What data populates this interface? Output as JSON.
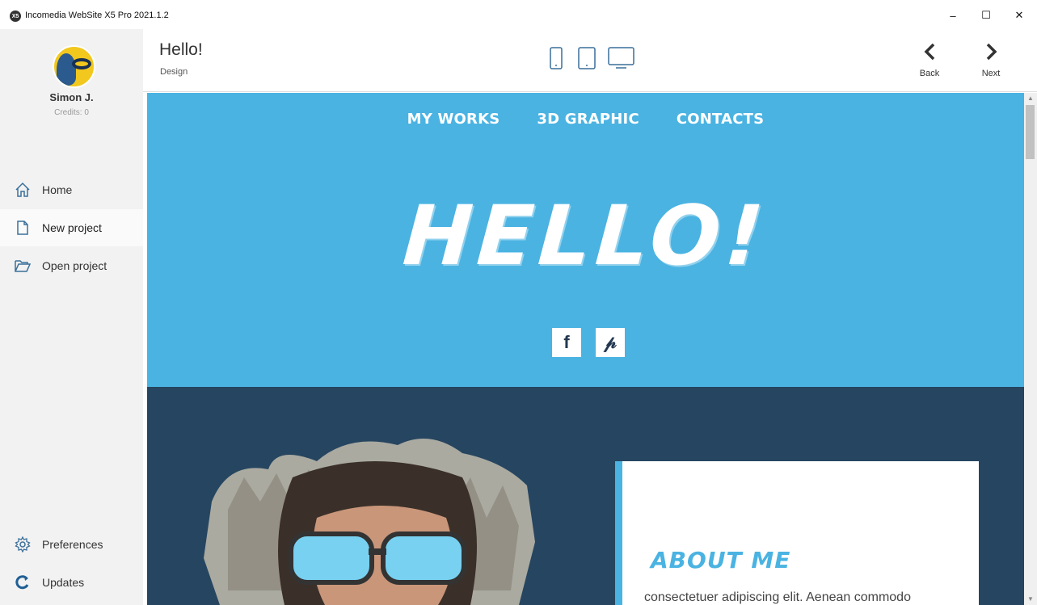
{
  "window": {
    "title": "Incomedia WebSite X5 Pro 2021.1.2",
    "icon_text": "X5",
    "minimize": "–",
    "maximize": "☐",
    "close": "✕"
  },
  "sidebar": {
    "user": {
      "name": "Simon J.",
      "credits": "Credits: 0"
    },
    "items": [
      {
        "label": "Home",
        "icon": "home-icon"
      },
      {
        "label": "New project",
        "icon": "new-file-icon",
        "active": true
      },
      {
        "label": "Open project",
        "icon": "folder-open-icon"
      }
    ],
    "bottom_items": [
      {
        "label": "Preferences",
        "icon": "gear-icon"
      },
      {
        "label": "Updates",
        "icon": "refresh-icon"
      }
    ]
  },
  "header": {
    "title": "Hello!",
    "subtitle": "Design",
    "back_label": "Back",
    "next_label": "Next"
  },
  "preview": {
    "menu": [
      "MY WORKS",
      "3D GRAPHIC",
      "CONTACTS"
    ],
    "hero_text": "HELLO!",
    "social": {
      "facebook": "f",
      "pinterest": "𝓅"
    },
    "about": {
      "title": "ABOUT ME",
      "text": "consectetuer adipiscing elit. Aenean commodo"
    },
    "scroll_up": "▲",
    "scroll_down": "▼"
  },
  "colors": {
    "hero": "#4ab3e2",
    "dark": "#264560",
    "sidebar": "#f2f2f2"
  }
}
